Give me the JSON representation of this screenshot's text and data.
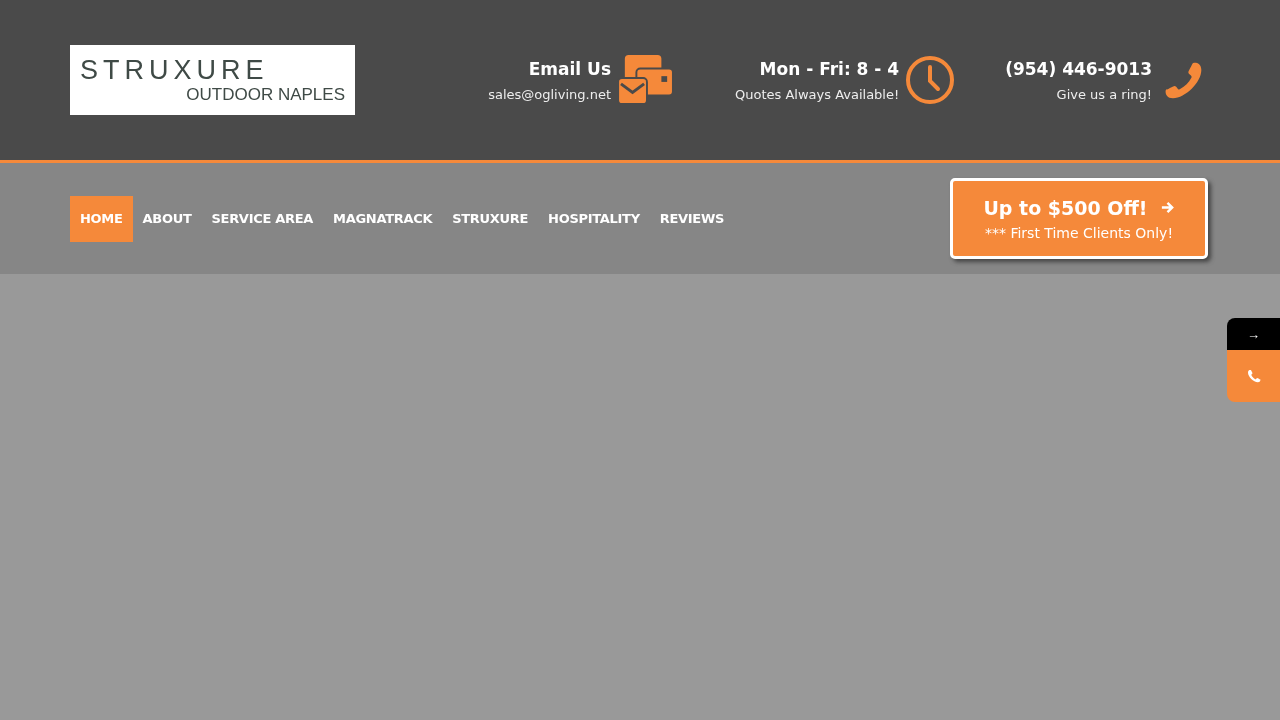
{
  "logo": {
    "brand": "STRUXURE",
    "subtitle": "OUTDOOR NAPLES"
  },
  "contacts": [
    {
      "kind": "email",
      "title": "Email Us",
      "subtitle": "sales@ogliving.net"
    },
    {
      "kind": "hours",
      "title": "Mon - Fri: 8 - 4",
      "subtitle": "Quotes Always Available!"
    },
    {
      "kind": "phone",
      "title": "(954) 446-9013",
      "subtitle": "Give us a ring!"
    }
  ],
  "nav": [
    {
      "label": "HOME",
      "selected": true
    },
    {
      "label": "ABOUT",
      "selected": false
    },
    {
      "label": "SERVICE AREA",
      "selected": false
    },
    {
      "label": "MAGNATRACK",
      "selected": false
    },
    {
      "label": "STRUXURE",
      "selected": false
    },
    {
      "label": "HOSPITALITY",
      "selected": false
    },
    {
      "label": "REVIEWS",
      "selected": false
    }
  ],
  "offer": {
    "title": "Up to $500 Off!",
    "subtitle": "*** First Time Clients Only!"
  },
  "side_widget": {
    "arrow": "→"
  }
}
